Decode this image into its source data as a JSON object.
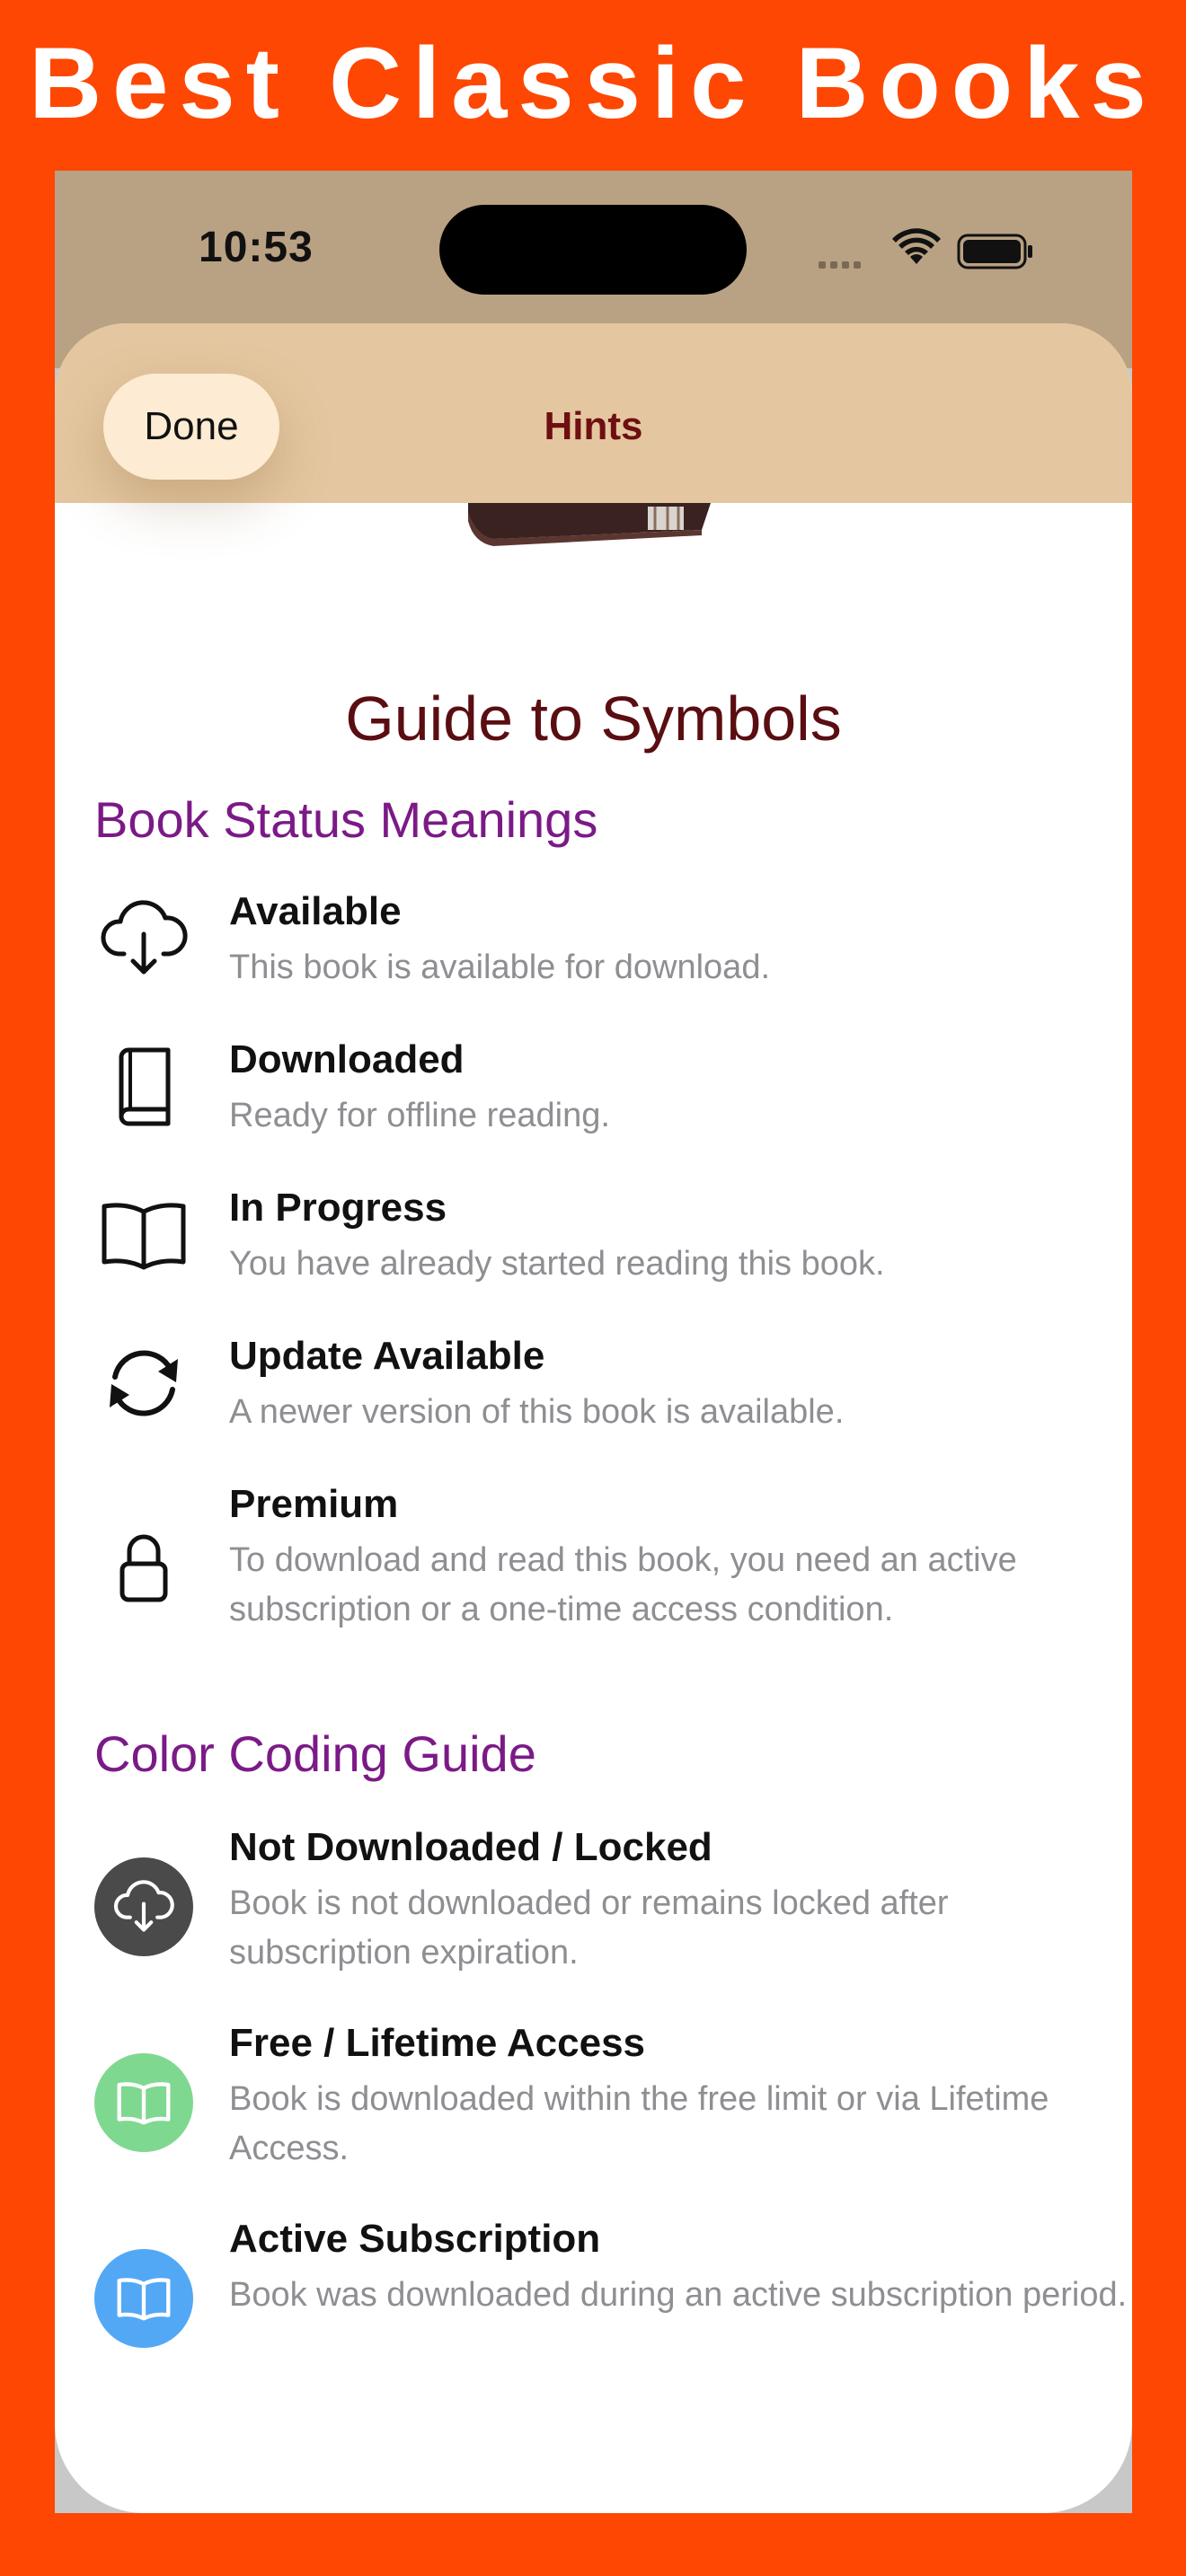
{
  "promo": {
    "title": "Best Classic Books"
  },
  "status_bar": {
    "time": "10:53"
  },
  "sheet": {
    "done_label": "Done",
    "title": "Hints"
  },
  "guide": {
    "title": "Guide to Symbols"
  },
  "book_status": {
    "heading": "Book Status Meanings",
    "items": [
      {
        "icon": "cloud-download-icon",
        "label": "Available",
        "desc": "This book is available for download."
      },
      {
        "icon": "book-closed-icon",
        "label": "Downloaded",
        "desc": "Ready for offline reading."
      },
      {
        "icon": "book-open-icon",
        "label": "In Progress",
        "desc": "You have already started reading this book."
      },
      {
        "icon": "refresh-icon",
        "label": "Update Available",
        "desc": "A newer version of this book is available."
      },
      {
        "icon": "lock-icon",
        "label": "Premium",
        "desc": "To download and read this book, you need an active subscription or a one-time access condition."
      }
    ]
  },
  "color_coding": {
    "heading": "Color Coding Guide",
    "items": [
      {
        "icon": "cloud-download-icon",
        "color": "#4A4A4A",
        "label": "Not Downloaded / Locked",
        "desc": "Book is not downloaded or remains locked after subscription expiration."
      },
      {
        "icon": "book-open-icon",
        "color": "#7FD88F",
        "label": "Free / Lifetime Access",
        "desc": "Book is downloaded within the free limit or via Lifetime Access."
      },
      {
        "icon": "book-open-icon",
        "color": "#52A8F5",
        "label": "Active Subscription",
        "desc": "Book was downloaded during an active subscription period."
      }
    ]
  }
}
